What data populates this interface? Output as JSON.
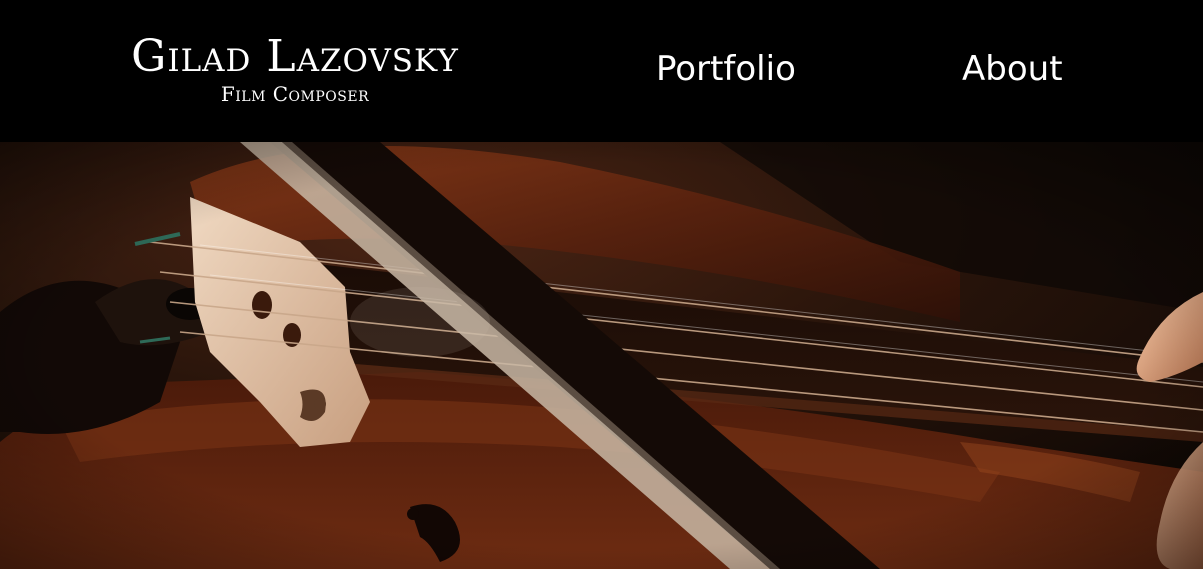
{
  "header": {
    "brand_name": "Gilad Lazovsky",
    "brand_tagline": "Film Composer",
    "nav": [
      {
        "label": "Portfolio"
      },
      {
        "label": "About"
      }
    ]
  },
  "hero": {
    "subject": "violin-photo"
  },
  "colors": {
    "header_bg": "#000000",
    "text": "#ffffff",
    "hero_dark": "#1c0f08",
    "violin_wood": "#6a2a12"
  }
}
